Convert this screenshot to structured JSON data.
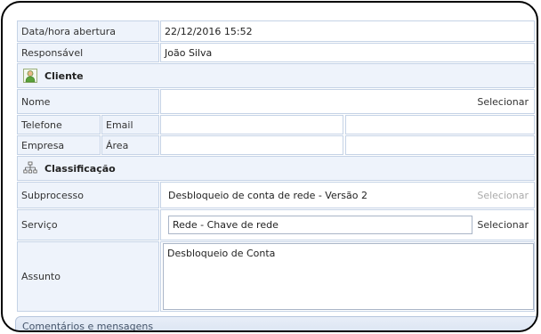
{
  "fields": {
    "opening_label": "Data/hora abertura",
    "opening_value": "22/12/2016 15:52",
    "responsible_label": "Responsável",
    "responsible_value": "João Silva"
  },
  "client": {
    "section_title": "Cliente",
    "name_label": "Nome",
    "select_label": "Selecionar",
    "phone_label": "Telefone",
    "email_label": "Email",
    "company_label": "Empresa",
    "area_label": "Área"
  },
  "classification": {
    "section_title": "Classificação",
    "subprocess_label": "Subprocesso",
    "subprocess_value": "Desbloqueio de conta de rede - Versão 2",
    "subprocess_select": "Selecionar",
    "service_label": "Serviço",
    "service_value": "Rede - Chave de rede",
    "service_select": "Selecionar",
    "subject_label": "Assunto",
    "subject_value": "Desbloqueio de Conta"
  },
  "footer": {
    "comments_label": "Comentários e mensagens"
  }
}
